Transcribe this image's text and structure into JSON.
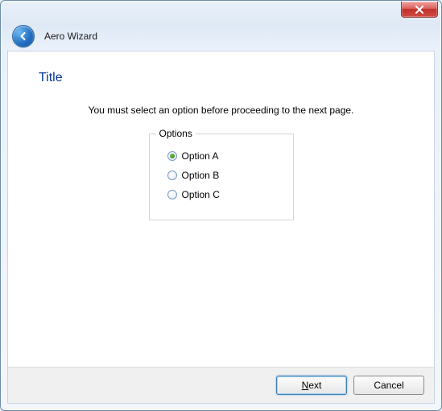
{
  "wizard": {
    "name": "Aero Wizard"
  },
  "page": {
    "title": "Title",
    "instruction": "You must select an option before proceeding to the next page."
  },
  "options": {
    "legend": "Options",
    "items": [
      {
        "label": "Option A",
        "selected": true
      },
      {
        "label": "Option B",
        "selected": false
      },
      {
        "label": "Option C",
        "selected": false
      }
    ]
  },
  "footer": {
    "next_prefix": "N",
    "next_rest": "ext",
    "cancel": "Cancel"
  }
}
